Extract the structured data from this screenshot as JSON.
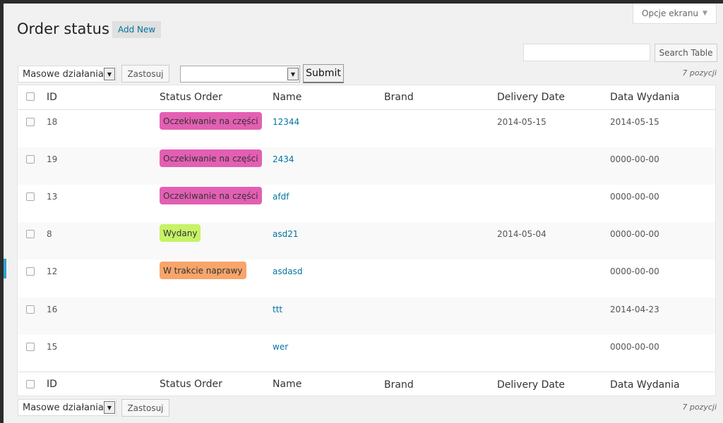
{
  "screen_options": {
    "label": "Opcje ekranu"
  },
  "page": {
    "title": "Order status",
    "add_new_label": "Add New"
  },
  "search": {
    "placeholder": "",
    "button_label": "Search Table"
  },
  "toolbar": {
    "bulk_actions": "Masowe działania",
    "apply_label": "Zastosuj",
    "status_select_value": "",
    "submit_label": "Submit",
    "item_count": "7 pozycji"
  },
  "columns": {
    "id": "ID",
    "status": "Status Order",
    "name": "Name",
    "brand": "Brand",
    "delivery": "Delivery Date",
    "issue": "Data Wydania"
  },
  "rows": [
    {
      "id": "18",
      "status": "Oczekiwanie na części",
      "status_color": "#e35fb3",
      "name": "12344",
      "brand": "",
      "delivery": "2014-05-15",
      "issue": "2014-05-15"
    },
    {
      "id": "19",
      "status": "Oczekiwanie na części",
      "status_color": "#e35fb3",
      "name": "2434",
      "brand": "",
      "delivery": "",
      "issue": "0000-00-00"
    },
    {
      "id": "13",
      "status": "Oczekiwanie na części",
      "status_color": "#e35fb3",
      "name": "afdf",
      "brand": "",
      "delivery": "",
      "issue": "0000-00-00"
    },
    {
      "id": "8",
      "status": "Wydany",
      "status_color": "#c6f266",
      "name": "asd21",
      "brand": "",
      "delivery": "2014-05-04",
      "issue": "0000-00-00"
    },
    {
      "id": "12",
      "status": "W trakcie naprawy",
      "status_color": "#f7a56b",
      "name": "asdasd",
      "brand": "",
      "delivery": "",
      "issue": "0000-00-00"
    },
    {
      "id": "16",
      "status": "",
      "status_color": "",
      "name": "ttt",
      "brand": "",
      "delivery": "",
      "issue": "2014-04-23"
    },
    {
      "id": "15",
      "status": "",
      "status_color": "",
      "name": "wer",
      "brand": "",
      "delivery": "",
      "issue": "0000-00-00"
    }
  ]
}
